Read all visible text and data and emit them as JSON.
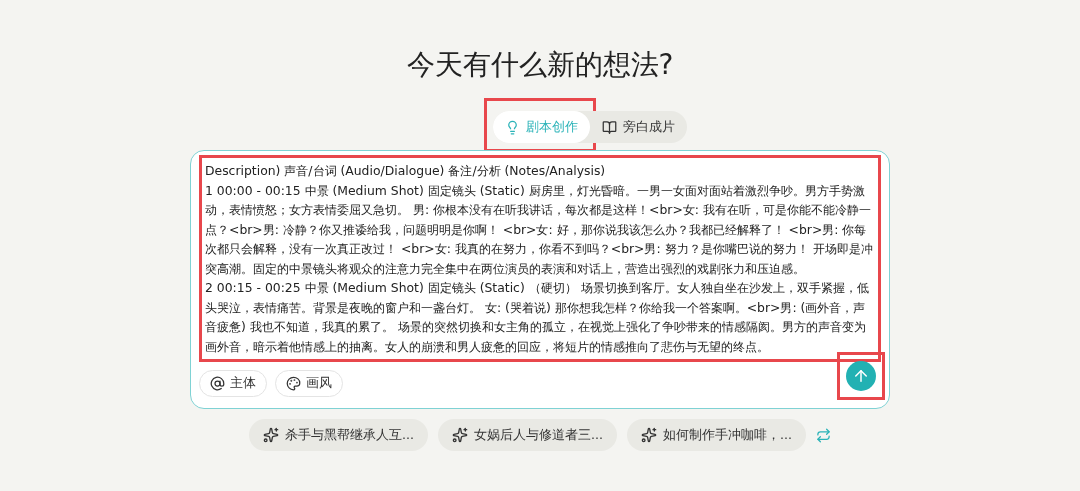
{
  "title": "今天有什么新的想法?",
  "tabs": [
    {
      "label": "剧本创作",
      "selected": true,
      "kind": "bulb"
    },
    {
      "label": "旁白成片",
      "selected": false,
      "kind": "book"
    }
  ],
  "prompt": {
    "paragraphs": [
      "Description) 声音/台词 (Audio/Dialogue) 备注/分析 (Notes/Analysis)",
      "1 00:00 - 00:15 中景 (Medium Shot) 固定镜头 (Static) 厨房里，灯光昏暗。一男一女面对面站着激烈争吵。男方手势激动，表情愤怒；女方表情委屈又急切。 男: 你根本没有在听我讲话，每次都是这样！<br>女: 我有在听，可是你能不能冷静一点？<br>男: 冷静？你又推诿给我，问题明明是你啊！ <br>女: 好，那你说我该怎么办？我都已经解释了！ <br>男: 你每次都只会解释，没有一次真正改过！ <br>女: 我真的在努力，你看不到吗？<br>男: 努力？是你嘴巴说的努力！ 开场即是冲突高潮。固定的中景镜头将观众的注意力完全集中在两位演员的表演和对话上，营造出强烈的戏剧张力和压迫感。",
      "2 00:15 - 00:25 中景 (Medium Shot) 固定镜头 (Static) （硬切） 场景切换到客厅。女人独自坐在沙发上，双手紧握，低头哭泣，表情痛苦。背景是夜晚的窗户和一盏台灯。 女: (哭着说) 那你想我怎样？你给我一个答案啊。<br>男: (画外音，声音疲惫) 我也不知道，我真的累了。 场景的突然切换和女主角的孤立，在视觉上强化了争吵带来的情感隔阂。男方的声音变为画外音，暗示着他情感上的抽离。女人的崩溃和男人疲惫的回应，将短片的情感推向了悲伤与无望的终点。"
    ]
  },
  "chips": [
    {
      "label": "主体",
      "kind": "at"
    },
    {
      "label": "画风",
      "kind": "palette"
    }
  ],
  "suggestions": [
    "杀手与黑帮继承人互...",
    "女娲后人与修道者三...",
    "如何制作手冲咖啡，..."
  ]
}
